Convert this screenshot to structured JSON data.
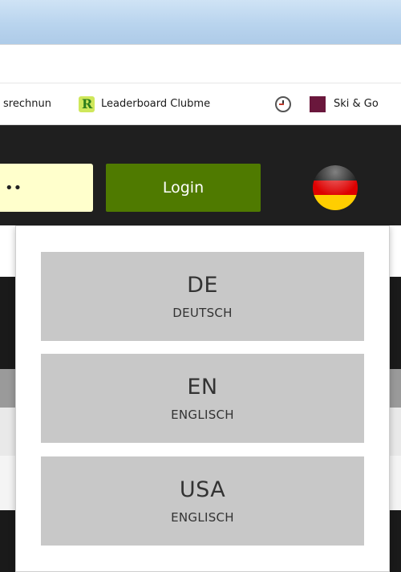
{
  "bookmarks": {
    "items": [
      {
        "label": "srechnun",
        "icon": "none"
      },
      {
        "label": "Leaderboard Clubme",
        "icon": "leaderboard-r-icon"
      },
      {
        "label": "",
        "icon": "clock-icon"
      },
      {
        "label": "Ski & Go",
        "icon": "maroon-square-icon"
      }
    ]
  },
  "header": {
    "password_value": "••",
    "login_label": "Login",
    "current_language_flag": "german-flag-icon"
  },
  "language_menu": {
    "options": [
      {
        "code": "DE",
        "name": "DEUTSCH"
      },
      {
        "code": "EN",
        "name": "ENGLISCH"
      },
      {
        "code": "USA",
        "name": "ENGLISCH"
      }
    ]
  },
  "colors": {
    "login_button": "#4f7a00",
    "header_background": "#1f1f1f",
    "option_background": "#c8c8c8",
    "password_field": "#ffffcc"
  }
}
